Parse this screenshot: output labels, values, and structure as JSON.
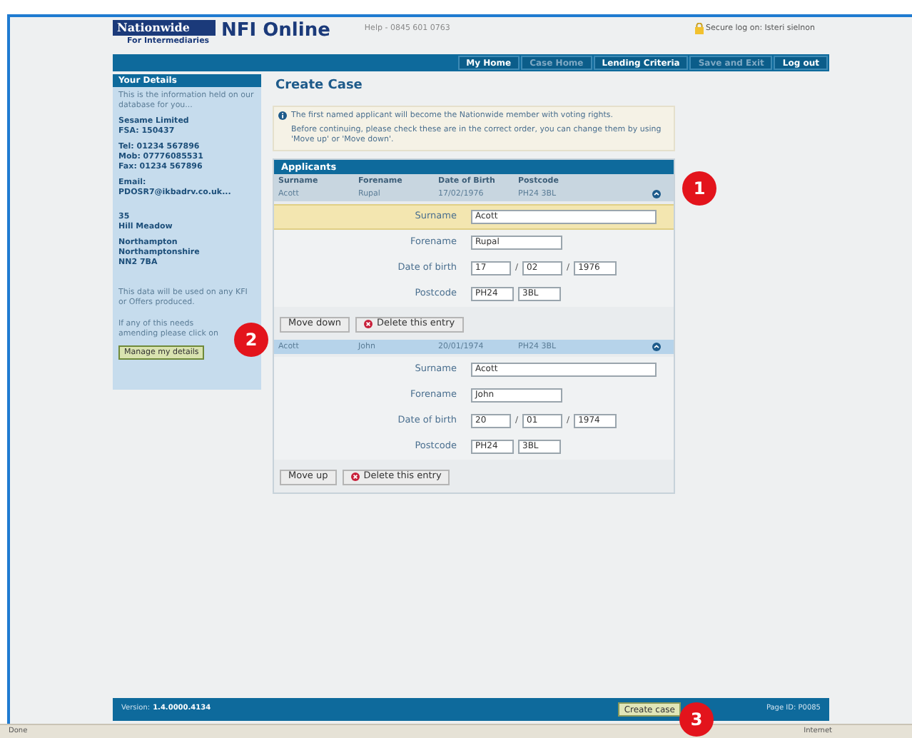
{
  "header": {
    "brand": "Nationwide",
    "brand_sub": "For Intermediaries",
    "product": "NFI Online",
    "help": "Help - 0845 601 0763",
    "secure": "Secure log on: Isteri sielnon"
  },
  "nav": [
    {
      "label": "My Home",
      "disabled": false
    },
    {
      "label": "Case Home",
      "disabled": true
    },
    {
      "label": "Lending Criteria",
      "disabled": false
    },
    {
      "label": "Save and Exit",
      "disabled": true
    },
    {
      "label": "Log out",
      "disabled": false
    }
  ],
  "sidebar": {
    "title": "Your Details",
    "intro": "This is the information held on our database for you...",
    "blocks": [
      [
        "Sesame Limited",
        "FSA: 150437"
      ],
      [
        "Tel: 01234 567896",
        "Mob: 07776085531",
        "Fax: 01234 567896"
      ],
      [
        "Email:",
        "PDOSR7@ikbadrv.co.uk..."
      ],
      [
        "35",
        "Hill Meadow"
      ],
      [
        "Northampton",
        "Northamptonshire",
        "NN2 7BA"
      ]
    ],
    "note": "This data will be used on any KFI or Offers produced.",
    "amend": "If any of this needs amending please click on",
    "button": "Manage my details"
  },
  "main": {
    "title": "Create Case",
    "info": "The first named applicant will become the Nationwide member with voting rights.",
    "info_2": "Before continuing, please check these are in the correct order, you can change them by using 'Move up' or 'Move down'.",
    "panel_title": "Applicants",
    "columns": [
      "Surname",
      "Forename",
      "Date of Birth",
      "Postcode"
    ],
    "applicants": [
      {
        "selected": false,
        "cells": [
          "Acott",
          "Rupal",
          "17/02/1976",
          "PH24 3BL"
        ],
        "fields": [
          {
            "label": "Surname",
            "kind": "text",
            "highlighted": true,
            "values": [
              "Acott"
            ]
          },
          {
            "label": "Forename",
            "kind": "short",
            "highlighted": false,
            "values": [
              "Rupal"
            ]
          },
          {
            "label": "Date of birth",
            "kind": "date",
            "highlighted": false,
            "values": [
              "17",
              "02",
              "1976"
            ],
            "separators": [
              "/",
              "/"
            ]
          },
          {
            "label": "Postcode",
            "kind": "postcode",
            "highlighted": false,
            "values": [
              "PH24",
              "3BL"
            ]
          }
        ],
        "move": "Move down",
        "delete": "Delete this entry"
      },
      {
        "selected": true,
        "cells": [
          "Acott",
          "John",
          "20/01/1974",
          "PH24 3BL"
        ],
        "fields": [
          {
            "label": "Surname",
            "kind": "text",
            "highlighted": false,
            "values": [
              "Acott"
            ]
          },
          {
            "label": "Forename",
            "kind": "short",
            "highlighted": false,
            "values": [
              "John"
            ]
          },
          {
            "label": "Date of birth",
            "kind": "date",
            "highlighted": false,
            "values": [
              "20",
              "01",
              "1974"
            ],
            "separators": [
              "/",
              "/"
            ]
          },
          {
            "label": "Postcode",
            "kind": "postcode",
            "highlighted": false,
            "values": [
              "PH24",
              "3BL"
            ]
          }
        ],
        "move": "Move up",
        "delete": "Delete this entry"
      }
    ]
  },
  "footer": {
    "version_label": "Version:",
    "version": "1.4.0000.4134",
    "button": "Create case",
    "page_id": "Page ID: P0085"
  },
  "status_bar": {
    "left": "Done",
    "right": "Internet"
  },
  "markers": [
    "1",
    "2",
    "3"
  ]
}
